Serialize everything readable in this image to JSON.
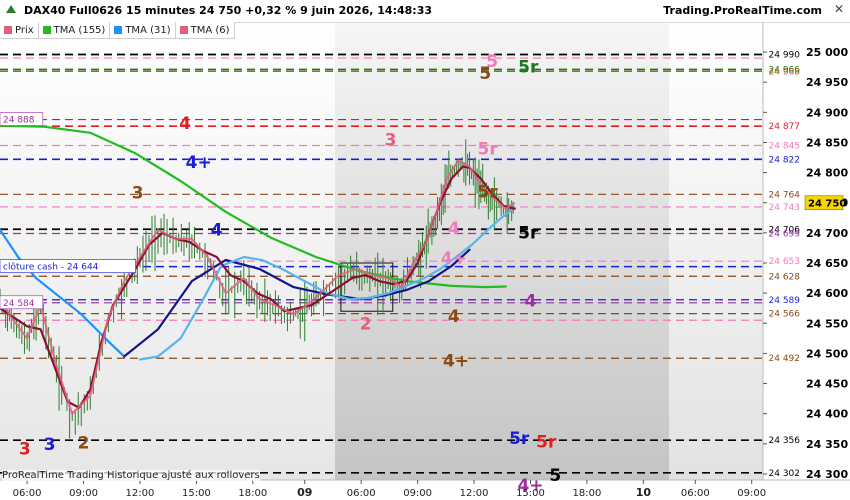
{
  "header": {
    "title": "DAX40 Full0626 15 minutes 24 750 +0,32 % 9 juin 2026, 14:48:33",
    "brand": "Trading.ProRealTime.com",
    "close_glyph": "✕"
  },
  "legend": [
    {
      "label": "Prix",
      "color": "#e0607e",
      "icon": "price-icon"
    },
    {
      "label": "TMA (155)",
      "color": "#22bb22",
      "icon": "tma-155-icon"
    },
    {
      "label": "TMA (31)",
      "color": "#1e90ff",
      "icon": "tma-31-icon"
    },
    {
      "label": "TMA (6)",
      "color": "#e0607e",
      "icon": "tma-6-icon"
    }
  ],
  "footer": "ProRealTime Trading  Historique ajusté aux rollovers",
  "chart_data": {
    "type": "line",
    "y_axis": {
      "min": 24290,
      "max": 25020,
      "ticks": [
        25000,
        24950,
        24900,
        24850,
        24800,
        24750,
        24700,
        24650,
        24600,
        24550,
        24500,
        24450,
        24400,
        24350,
        24300
      ],
      "tick_labels": [
        "25 000",
        "24 950",
        "24 900",
        "24 850",
        "24 800",
        "24 750",
        "24 700",
        "24 650",
        "24 600",
        "24 550",
        "24 500",
        "24 450",
        "24 400",
        "24 350",
        "24 300"
      ],
      "current": {
        "value": 24750,
        "label": "24 750"
      }
    },
    "x_axis": {
      "min": 0,
      "max": 23.8,
      "ticks": [
        {
          "t": 1.2,
          "label": "06:00",
          "bold": false
        },
        {
          "t": 3.7,
          "label": "09:00",
          "bold": false
        },
        {
          "t": 6.2,
          "label": "12:00",
          "bold": false
        },
        {
          "t": 8.7,
          "label": "15:00",
          "bold": false
        },
        {
          "t": 11.2,
          "label": "18:00",
          "bold": false
        },
        {
          "t": 13.5,
          "label": "09",
          "bold": true
        },
        {
          "t": 16.0,
          "label": "06:00",
          "bold": false
        },
        {
          "t": 18.5,
          "label": "09:00",
          "bold": false
        },
        {
          "t": 21.0,
          "label": "12:00",
          "bold": false
        },
        {
          "t": 23.5,
          "label": "15:00",
          "bold": false
        },
        {
          "t": 26.0,
          "label": "18:00",
          "bold": false
        },
        {
          "t": 28.5,
          "label": "10",
          "bold": true
        },
        {
          "t": 30.8,
          "label": "06:00",
          "bold": false
        },
        {
          "t": 33.3,
          "label": "09:00",
          "bold": false
        }
      ],
      "view_min": 0,
      "view_max": 33.8
    },
    "series": [
      {
        "name": "Prix",
        "color": "#e0607e",
        "x": [
          0,
          0.5,
          1.2,
          1.8,
          2.5,
          3.2,
          4.0,
          4.8,
          5.5,
          6.2,
          7.0,
          7.8,
          8.5,
          9.2,
          10.0,
          10.8,
          11.5,
          12.2,
          13.0,
          13.6,
          14.2,
          15.0,
          15.8,
          16.5,
          17.2,
          17.8,
          18.3,
          18.8,
          19.3,
          19.8,
          20.3,
          20.8,
          21.3,
          21.8,
          22.4,
          22.8
        ],
        "values": [
          24590,
          24560,
          24525,
          24580,
          24480,
          24400,
          24430,
          24560,
          24620,
          24660,
          24705,
          24690,
          24690,
          24660,
          24600,
          24625,
          24590,
          24580,
          24565,
          24580,
          24600,
          24630,
          24640,
          24630,
          24625,
          24610,
          24650,
          24680,
          24730,
          24790,
          24820,
          24810,
          24780,
          24760,
          24740,
          24750
        ]
      },
      {
        "name": "TMA (155)",
        "color": "#22bb22",
        "x": [
          0,
          2.0,
          4.0,
          6.0,
          8.0,
          10.0,
          12.0,
          14.0,
          16.0,
          18.0,
          20.0,
          21.5,
          22.4
        ],
        "values": [
          24878,
          24876,
          24866,
          24832,
          24786,
          24735,
          24692,
          24660,
          24636,
          24620,
          24612,
          24610,
          24611
        ]
      },
      {
        "name": "TMA (31)",
        "color": "#1e90ff",
        "x": [
          0,
          0.8,
          1.6,
          2.6,
          3.6,
          4.8,
          5.5
        ],
        "values": [
          24705,
          24660,
          24625,
          24595,
          24565,
          24520,
          24495
        ]
      },
      {
        "name": "",
        "color": "#14148c",
        "x": [
          5.5,
          7.0,
          8.5,
          10.0,
          11.5,
          13.0,
          14.5,
          16.0,
          17.0,
          18.0,
          19.0,
          20.0,
          20.8
        ],
        "values": [
          24495,
          24540,
          24620,
          24655,
          24640,
          24610,
          24598,
          24590,
          24596,
          24605,
          24620,
          24645,
          24672
        ]
      },
      {
        "name": "",
        "color": "#5ab4f0",
        "x": [
          6.2,
          7.0,
          8.0,
          9.0,
          9.8,
          10.8,
          11.6,
          12.5,
          13.5,
          14.5,
          15.5,
          16.3,
          17.2,
          18.0,
          18.8,
          19.5,
          20.2,
          20.9,
          21.6,
          22.3,
          22.8
        ],
        "values": [
          24490,
          24495,
          24525,
          24590,
          24645,
          24660,
          24655,
          24640,
          24620,
          24600,
          24590,
          24592,
          24600,
          24612,
          24625,
          24640,
          24660,
          24680,
          24705,
          24728,
          24742
        ]
      },
      {
        "name": "",
        "color": "#8b0f35",
        "x": [
          0,
          0.6,
          1.2,
          1.8,
          2.5,
          3.0,
          3.5,
          4.0,
          4.5,
          5.0,
          5.5,
          6.0,
          6.6,
          7.2,
          7.8,
          8.4,
          9.0,
          9.6,
          10.2,
          10.8,
          11.4,
          12.0,
          12.6,
          13.2,
          13.8,
          14.4,
          15.0,
          15.6,
          16.2,
          16.8,
          17.4,
          18.0,
          18.5,
          19.0,
          19.5,
          20.0,
          20.5,
          20.8,
          21.3,
          21.8,
          22.3,
          22.8
        ],
        "values": [
          24575,
          24560,
          24545,
          24540,
          24470,
          24420,
          24410,
          24440,
          24520,
          24580,
          24610,
          24640,
          24680,
          24700,
          24690,
          24685,
          24670,
          24660,
          24630,
          24620,
          24600,
          24590,
          24570,
          24575,
          24580,
          24595,
          24610,
          24625,
          24630,
          24620,
          24615,
          24620,
          24650,
          24700,
          24750,
          24790,
          24810,
          24808,
          24790,
          24765,
          24745,
          24740
        ]
      }
    ],
    "levels": [
      {
        "value": 24996,
        "color": "#000000",
        "label": "24 990",
        "lw": 1.8
      },
      {
        "value": 24990,
        "color": "#f27ab8",
        "label": "",
        "lw": 1.2
      },
      {
        "value": 24971,
        "color": "#1a7a1a",
        "label": "24 966",
        "lw": 1.8
      },
      {
        "value": 24968,
        "color": "#b06020",
        "label": "24 968",
        "lw": 1.2
      },
      {
        "value": 24888,
        "color": "#a020a0",
        "label": "",
        "lw": 1.2
      },
      {
        "value": 24877,
        "color": "#e02020",
        "label": "24 877",
        "lw": 1.6
      },
      {
        "value": 24845,
        "color": "#f27ab8",
        "label": "24 845",
        "lw": 1.2
      },
      {
        "value": 24822,
        "color": "#1c1cd8",
        "label": "24 822",
        "lw": 1.6
      },
      {
        "value": 24764,
        "color": "#8a4a14",
        "label": "24 764",
        "lw": 1.2
      },
      {
        "value": 24743,
        "color": "#f27ab8",
        "label": "24 743",
        "lw": 1.2
      },
      {
        "value": 24706,
        "color": "#000000",
        "label": "24 706",
        "lw": 1.8
      },
      {
        "value": 24699,
        "color": "#9b2f9b",
        "label": "24 699",
        "lw": 1.2
      },
      {
        "value": 24653,
        "color": "#f27ab8",
        "label": "24 653",
        "lw": 1.2
      },
      {
        "value": 24644,
        "color": "#1c1cd8",
        "label": "",
        "lw": 1.4
      },
      {
        "value": 24628,
        "color": "#8a4a14",
        "label": "24 628",
        "lw": 1.2
      },
      {
        "value": 24589,
        "color": "#1c1cd8",
        "label": "24 589",
        "lw": 1.2
      },
      {
        "value": 24584,
        "color": "#9b2f9b",
        "label": "",
        "lw": 1.2
      },
      {
        "value": 24566,
        "color": "#8a4a14",
        "label": "24 566",
        "lw": 1.2
      },
      {
        "value": 24555,
        "color": "#f27ab8",
        "label": "",
        "lw": 1.2
      },
      {
        "value": 24492,
        "color": "#8a4a14",
        "label": "24 492",
        "lw": 1.2
      },
      {
        "value": 24356,
        "color": "#000000",
        "label": "24 356",
        "lw": 1.6
      },
      {
        "value": 24302,
        "color": "#000000",
        "label": "24 302",
        "lw": 1.6
      }
    ],
    "left_labels": [
      {
        "value": 24888,
        "text": "24 888",
        "color": "#9b2f9b"
      },
      {
        "value": 24644,
        "text": "clôture cash -  24 644",
        "color": "#1c1cd8"
      },
      {
        "value": 24584,
        "text": "24 584",
        "color": "#9b2f9b"
      }
    ],
    "annotations": [
      {
        "t": 21.8,
        "v": 24985,
        "text": "5",
        "color": "#f27ab8"
      },
      {
        "t": 23.4,
        "v": 24976,
        "text": "5r",
        "color": "#1a7a1a"
      },
      {
        "t": 21.5,
        "v": 24965,
        "text": "5",
        "color": "#8a4a14"
      },
      {
        "t": 8.2,
        "v": 24882,
        "text": "4",
        "color": "#e02020"
      },
      {
        "t": 21.6,
        "v": 24840,
        "text": "5r",
        "color": "#f27ab8"
      },
      {
        "t": 8.8,
        "v": 24818,
        "text": "4+",
        "color": "#1c1cd8"
      },
      {
        "t": 17.3,
        "v": 24855,
        "text": "3",
        "color": "#e0607e"
      },
      {
        "t": 21.6,
        "v": 24769,
        "text": "5r",
        "color": "#8a4a14"
      },
      {
        "t": 6.1,
        "v": 24767,
        "text": "3",
        "color": "#8a4a14"
      },
      {
        "t": 20.1,
        "v": 24708,
        "text": "4",
        "color": "#f27ab8"
      },
      {
        "t": 23.4,
        "v": 24701,
        "text": "5r",
        "color": "#000000"
      },
      {
        "t": 9.6,
        "v": 24706,
        "text": "4",
        "color": "#1c1cd8"
      },
      {
        "t": 20.1,
        "v": 24658,
        "text": "4+",
        "color": "#f27ab8"
      },
      {
        "t": 23.5,
        "v": 24588,
        "text": "4",
        "color": "#9b2f9b"
      },
      {
        "t": 16.2,
        "v": 24550,
        "text": "2",
        "color": "#e0607e"
      },
      {
        "t": 20.1,
        "v": 24562,
        "text": "4",
        "color": "#8a4a14"
      },
      {
        "t": 20.2,
        "v": 24488,
        "text": "4+",
        "color": "#8a4a14"
      },
      {
        "t": 1.1,
        "v": 24342,
        "text": "3",
        "color": "#e02020"
      },
      {
        "t": 2.2,
        "v": 24350,
        "text": "3",
        "color": "#1c1cd8"
      },
      {
        "t": 3.7,
        "v": 24352,
        "text": "2",
        "color": "#8a4a14"
      },
      {
        "t": 23.0,
        "v": 24360,
        "text": "5r",
        "color": "#1c1cd8"
      },
      {
        "t": 24.2,
        "v": 24354,
        "text": "5r",
        "color": "#e02020"
      },
      {
        "t": 23.5,
        "v": 24282,
        "text": "4+",
        "color": "#9b2f9b"
      },
      {
        "t": 24.6,
        "v": 24298,
        "text": "5",
        "color": "#000000"
      }
    ],
    "range_box": {
      "t0": 15.1,
      "t1": 17.4,
      "v0": 24570,
      "v1": 24650
    }
  }
}
